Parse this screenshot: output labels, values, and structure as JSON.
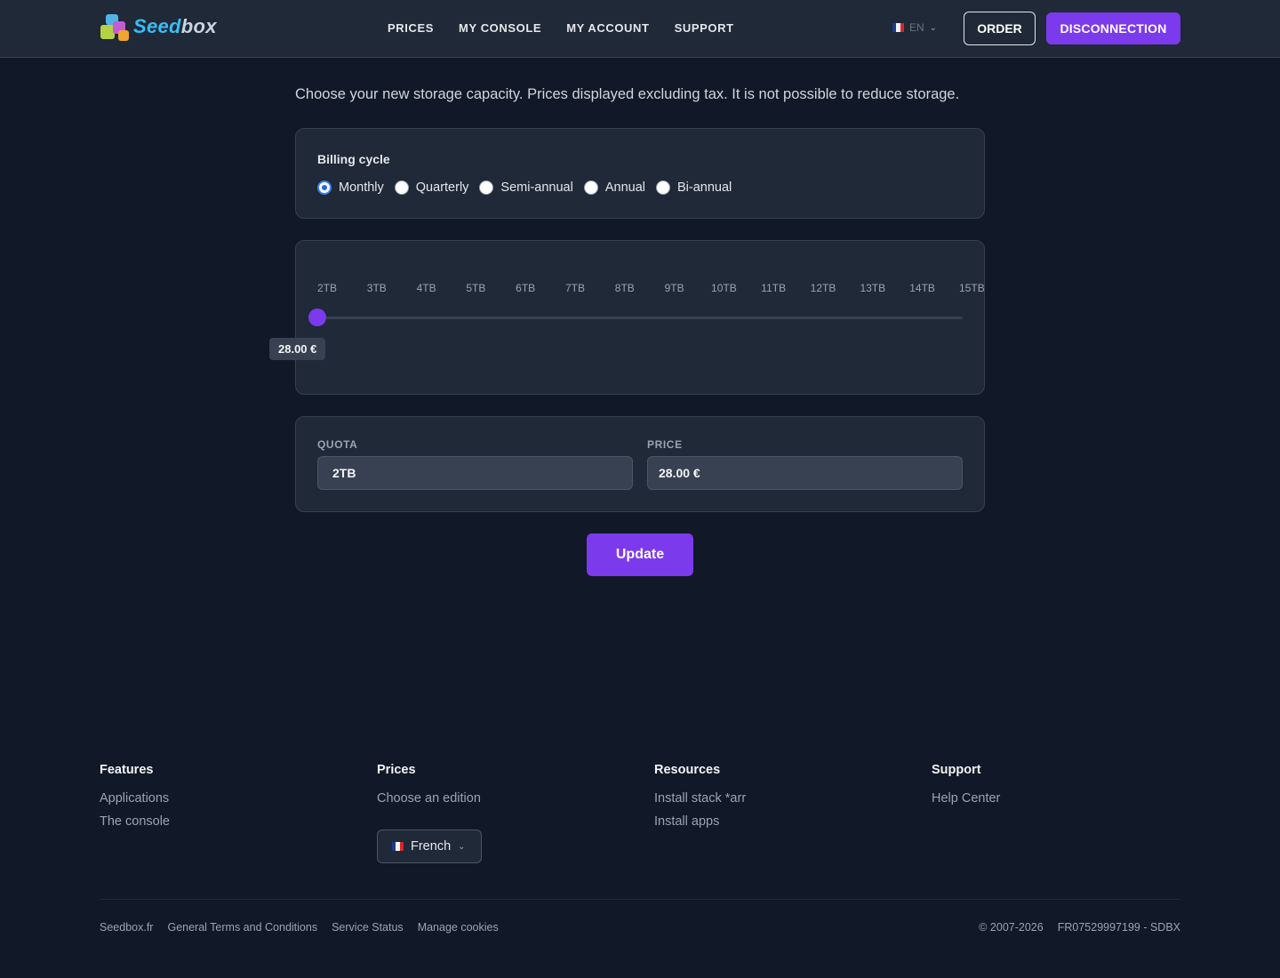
{
  "header": {
    "logo_text_a": "Seed",
    "logo_text_b": "box",
    "nav": [
      "PRICES",
      "MY CONSOLE",
      "MY ACCOUNT",
      "SUPPORT"
    ],
    "lang": "EN",
    "order_label": "ORDER",
    "disconnect_label": "DISCONNECTION"
  },
  "main": {
    "intro": "Choose your new storage capacity. Prices displayed excluding tax. It is not possible to reduce storage.",
    "billing": {
      "label": "Billing cycle",
      "options": [
        "Monthly",
        "Quarterly",
        "Semi-annual",
        "Annual",
        "Bi-annual"
      ],
      "selected": "Monthly"
    },
    "slider": {
      "ticks": [
        "2TB",
        "3TB",
        "4TB",
        "5TB",
        "6TB",
        "7TB",
        "8TB",
        "9TB",
        "10TB",
        "11TB",
        "12TB",
        "13TB",
        "14TB",
        "15TB"
      ],
      "selected_value": "2TB",
      "price_tooltip": "28.00 €"
    },
    "summary": {
      "quota_label": "QUOTA",
      "quota_value": "2TB",
      "price_label": "PRICE",
      "price_value": "28.00 €"
    },
    "update_label": "Update"
  },
  "footer": {
    "columns": [
      {
        "title": "Features",
        "links": [
          "Applications",
          "The console"
        ]
      },
      {
        "title": "Prices",
        "links": [
          "Choose an edition"
        ]
      },
      {
        "title": "Resources",
        "links": [
          "Install stack *arr",
          "Install apps"
        ]
      },
      {
        "title": "Support",
        "links": [
          "Help Center"
        ]
      }
    ],
    "language_select": "French",
    "legal_links": [
      "Seedbox.fr",
      "General Terms and Conditions",
      "Service Status",
      "Manage cookies"
    ],
    "copyright": "© 2007-2026",
    "company_id": "FR07529997199 - SDBX"
  },
  "colors": {
    "background": "#111827",
    "panel": "#1f2937",
    "accent": "#7c3aed",
    "radio_selected": "#2563eb"
  },
  "icons": [
    "seedbox-logo",
    "flag-fr-icon",
    "chevron-down-icon",
    "radio-icon",
    "slider-thumb"
  ]
}
